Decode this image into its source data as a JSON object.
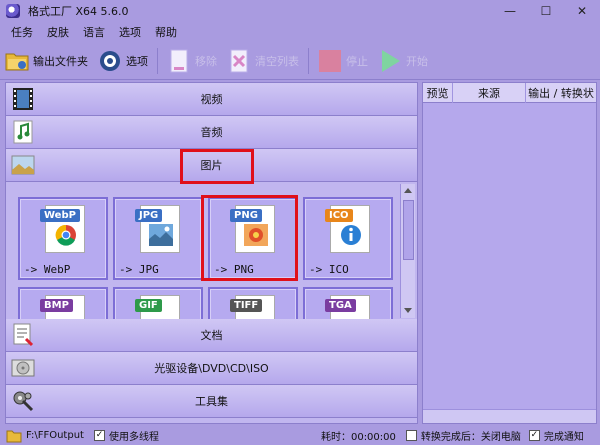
{
  "window": {
    "title": "格式工厂 X64 5.6.0",
    "min": "—",
    "max": "☐",
    "close": "✕"
  },
  "menu": [
    "任务",
    "皮肤",
    "语言",
    "选项",
    "帮助"
  ],
  "toolbar": {
    "output_folder": "输出文件夹",
    "options": "选项",
    "remove": "移除",
    "clear_list": "清空列表",
    "stop": "停止",
    "start": "开始"
  },
  "categories": {
    "video": "视频",
    "audio": "音频",
    "image": "图片",
    "document": "文档",
    "optical": "光驱设备\\DVD\\CD\\ISO",
    "tools": "工具集"
  },
  "formats_row1": [
    {
      "badge": "WebP",
      "label": "-> WebP",
      "badge_color": "#3a6fc4",
      "icon": "chrome-icon"
    },
    {
      "badge": "JPG",
      "label": "-> JPG",
      "badge_color": "#3a6fc4",
      "icon": "landscape-icon"
    },
    {
      "badge": "PNG",
      "label": "-> PNG",
      "badge_color": "#3a6fc4",
      "icon": "flower-icon"
    },
    {
      "badge": "ICO",
      "label": "-> ICO",
      "badge_color": "#e8861a",
      "icon": "info-icon"
    }
  ],
  "formats_row2": [
    {
      "badge": "BMP",
      "badge_color": "#7a3ca0"
    },
    {
      "badge": "GIF",
      "badge_color": "#2e9a4a"
    },
    {
      "badge": "TIFF",
      "badge_color": "#555555"
    },
    {
      "badge": "TGA",
      "badge_color": "#7a3ca0"
    }
  ],
  "task_columns": [
    "预览",
    "来源",
    "输出 / 转换状"
  ],
  "status": {
    "output_path": "F:\\FFOutput",
    "multithread": "使用多线程",
    "elapsed": "耗时：00:00:00",
    "after_convert": "转换完成后：关闭电脑",
    "notify": "完成通知"
  },
  "colors": {
    "highlight": "#e0101a",
    "accent": "#a99be0"
  }
}
